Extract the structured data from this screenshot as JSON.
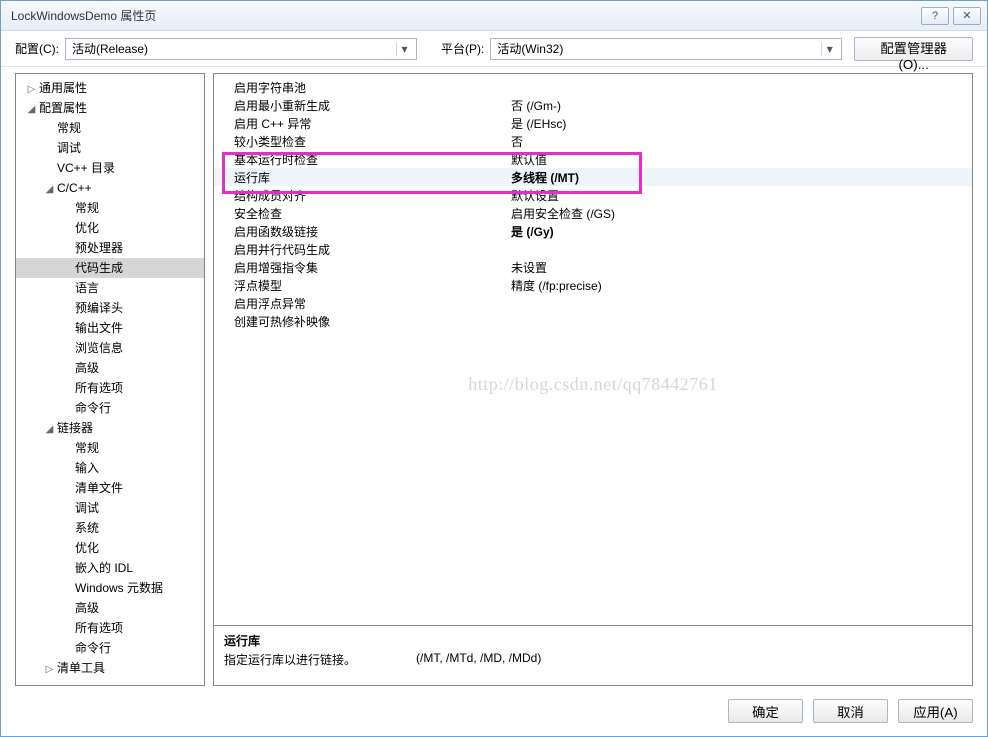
{
  "window": {
    "title": "LockWindowsDemo 属性页",
    "help": "?",
    "close": "✕"
  },
  "toolbar": {
    "config_label": "配置(C):",
    "config_value": "活动(Release)",
    "platform_label": "平台(P):",
    "platform_value": "活动(Win32)",
    "cfg_mgr": "配置管理器(O)..."
  },
  "tree": [
    {
      "label": "通用属性",
      "depth": 0,
      "tw": "▷"
    },
    {
      "label": "配置属性",
      "depth": 0,
      "tw": "◢"
    },
    {
      "label": "常规",
      "depth": 1,
      "tw": ""
    },
    {
      "label": "调试",
      "depth": 1,
      "tw": ""
    },
    {
      "label": "VC++ 目录",
      "depth": 1,
      "tw": ""
    },
    {
      "label": "C/C++",
      "depth": 1,
      "tw": "◢"
    },
    {
      "label": "常规",
      "depth": 2,
      "tw": ""
    },
    {
      "label": "优化",
      "depth": 2,
      "tw": ""
    },
    {
      "label": "预处理器",
      "depth": 2,
      "tw": ""
    },
    {
      "label": "代码生成",
      "depth": 2,
      "tw": "",
      "sel": true
    },
    {
      "label": "语言",
      "depth": 2,
      "tw": ""
    },
    {
      "label": "预编译头",
      "depth": 2,
      "tw": ""
    },
    {
      "label": "输出文件",
      "depth": 2,
      "tw": ""
    },
    {
      "label": "浏览信息",
      "depth": 2,
      "tw": ""
    },
    {
      "label": "高级",
      "depth": 2,
      "tw": ""
    },
    {
      "label": "所有选项",
      "depth": 2,
      "tw": ""
    },
    {
      "label": "命令行",
      "depth": 2,
      "tw": ""
    },
    {
      "label": "链接器",
      "depth": 1,
      "tw": "◢"
    },
    {
      "label": "常规",
      "depth": 2,
      "tw": ""
    },
    {
      "label": "输入",
      "depth": 2,
      "tw": ""
    },
    {
      "label": "清单文件",
      "depth": 2,
      "tw": ""
    },
    {
      "label": "调试",
      "depth": 2,
      "tw": ""
    },
    {
      "label": "系统",
      "depth": 2,
      "tw": ""
    },
    {
      "label": "优化",
      "depth": 2,
      "tw": ""
    },
    {
      "label": "嵌入的 IDL",
      "depth": 2,
      "tw": ""
    },
    {
      "label": "Windows 元数据",
      "depth": 2,
      "tw": ""
    },
    {
      "label": "高级",
      "depth": 2,
      "tw": ""
    },
    {
      "label": "所有选项",
      "depth": 2,
      "tw": ""
    },
    {
      "label": "命令行",
      "depth": 2,
      "tw": ""
    },
    {
      "label": "清单工具",
      "depth": 1,
      "tw": "▷"
    }
  ],
  "grid": [
    {
      "name": "启用字符串池",
      "value": ""
    },
    {
      "name": "启用最小重新生成",
      "value": "否 (/Gm-)"
    },
    {
      "name": "启用 C++ 异常",
      "value": "是 (/EHsc)"
    },
    {
      "name": "较小类型检查",
      "value": "否"
    },
    {
      "name": "基本运行时检查",
      "value": "默认值"
    },
    {
      "name": "运行库",
      "value": "多线程 (/MT)",
      "sel": true,
      "bold": true
    },
    {
      "name": "结构成员对齐",
      "value": "默认设置"
    },
    {
      "name": "安全检查",
      "value": "启用安全检查 (/GS)"
    },
    {
      "name": "启用函数级链接",
      "value": "是 (/Gy)",
      "bold": true
    },
    {
      "name": "启用并行代码生成",
      "value": ""
    },
    {
      "name": "启用增强指令集",
      "value": "未设置"
    },
    {
      "name": "浮点模型",
      "value": "精度 (/fp:precise)"
    },
    {
      "name": "启用浮点异常",
      "value": ""
    },
    {
      "name": "创建可热修补映像",
      "value": ""
    }
  ],
  "watermark": "http://blog.csdn.net/qq78442761",
  "desc": {
    "title": "运行库",
    "text": "指定运行库以进行链接。",
    "opts": "(/MT, /MTd, /MD, /MDd)"
  },
  "buttons": {
    "ok": "确定",
    "cancel": "取消",
    "apply": "应用(A)"
  }
}
